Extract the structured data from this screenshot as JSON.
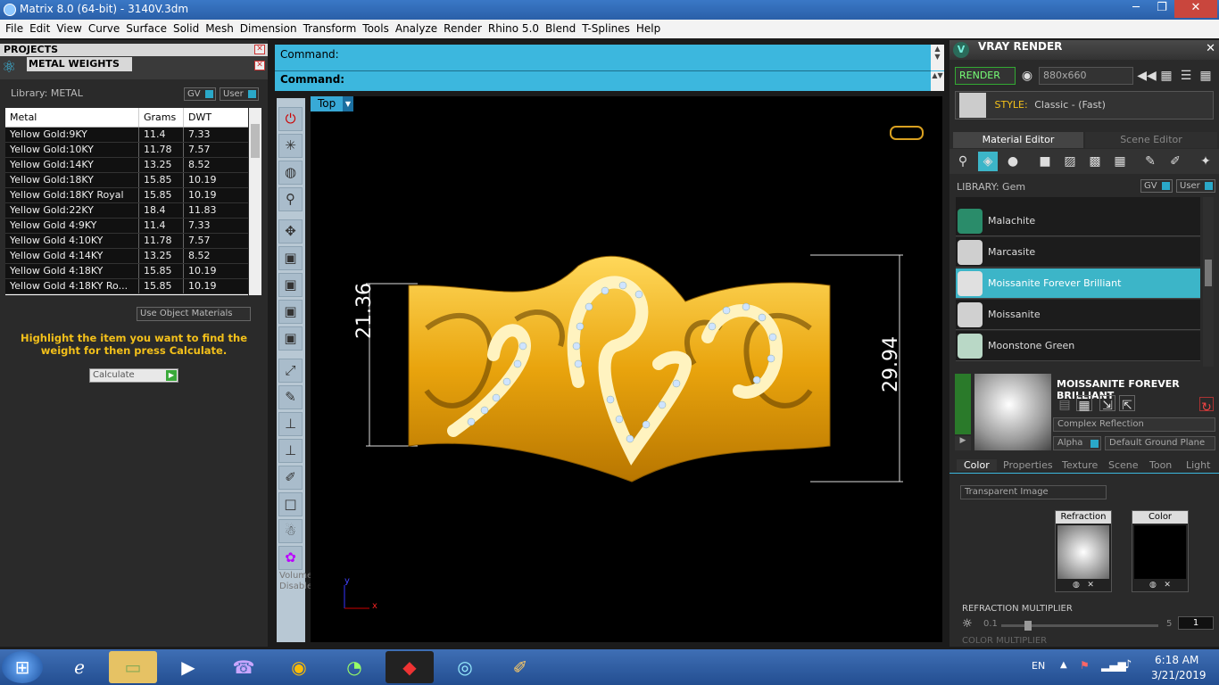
{
  "window": {
    "title": "Matrix 8.0 (64-bit) - 3140V.3dm",
    "min": "─",
    "max": "❐",
    "close": "✕"
  },
  "menu": [
    "File",
    "Edit",
    "View",
    "Curve",
    "Surface",
    "Solid",
    "Mesh",
    "Dimension",
    "Transform",
    "Tools",
    "Analyze",
    "Render",
    "Rhino 5.0",
    "Blend",
    "T-Splines",
    "Help"
  ],
  "left": {
    "projects_title": "PROJECTS",
    "panel_title": "METAL WEIGHTS",
    "library_label": "Library: METAL",
    "gv": "GV",
    "user": "User",
    "headers": [
      "Metal",
      "Grams",
      "DWT"
    ],
    "rows": [
      [
        "Yellow Gold:9KY",
        "11.4",
        "7.33"
      ],
      [
        "Yellow Gold:10KY",
        "11.78",
        "7.57"
      ],
      [
        "Yellow Gold:14KY",
        "13.25",
        "8.52"
      ],
      [
        "Yellow Gold:18KY",
        "15.85",
        "10.19"
      ],
      [
        "Yellow Gold:18KY Royal",
        "15.85",
        "10.19"
      ],
      [
        "Yellow Gold:22KY",
        "18.4",
        "11.83"
      ],
      [
        "Yellow Gold 4:9KY",
        "11.4",
        "7.33"
      ],
      [
        "Yellow Gold 4:10KY",
        "11.78",
        "7.57"
      ],
      [
        "Yellow Gold 4:14KY",
        "13.25",
        "8.52"
      ],
      [
        "Yellow Gold 4:18KY",
        "15.85",
        "10.19"
      ],
      [
        "Yellow Gold 4:18KY Ro...",
        "15.85",
        "10.19"
      ]
    ],
    "use_object_materials": "Use Object Materials",
    "instruction": "Highlight the item you want to find the weight for then press Calculate.",
    "calculate": "Calculate"
  },
  "command": {
    "line1": "Command:",
    "line2": "Command:"
  },
  "viewport": {
    "label": "Top",
    "dim_left": "21.36",
    "dim_right": "29.94",
    "axis_y": "y",
    "axis_x": "x"
  },
  "toolbar_text": "Volume Disabled",
  "right": {
    "title": "VRAY RENDER",
    "render_btn": "RENDER",
    "resolution": "880x660",
    "style_label": "STYLE:",
    "style_value": "Classic - (Fast)",
    "tab_material": "Material Editor",
    "tab_scene": "Scene Editor",
    "library_label": "LIBRARY: Gem",
    "gv": "GV",
    "user": "User",
    "gems": [
      {
        "name": "Malachite",
        "color": "#2a8c6a"
      },
      {
        "name": "Marcasite",
        "color": "#cfcfcf"
      },
      {
        "name": "Moissanite Forever Brilliant",
        "color": "#e0e0e0"
      },
      {
        "name": "Moissanite",
        "color": "#d0d0d0"
      },
      {
        "name": "Moonstone Green",
        "color": "#b9d8c6"
      }
    ],
    "selected_gem": "MOISSANITE FOREVER BRILLIANT",
    "reflection": "Complex Reflection",
    "alpha": "Alpha",
    "ground": "Default Ground Plane",
    "subtabs": [
      "Color",
      "Properties",
      "Texture",
      "Scene",
      "Toon",
      "Light"
    ],
    "transparent": "Transparent Image",
    "refraction_label": "Refraction",
    "color_label": "Color",
    "refraction_multiplier": "REFRACTION MULTIPLIER",
    "slider_min": "0.1",
    "slider_max": "5",
    "slider_value": "1",
    "color_multiplier": "COLOR MULTIPLIER"
  },
  "taskbar": {
    "lang": "EN",
    "time": "6:18 AM",
    "date": "3/21/2019"
  },
  "colors": {
    "accent": "#3cb7de",
    "gold": "#f2b21b",
    "selection": "#3cb5c8"
  }
}
